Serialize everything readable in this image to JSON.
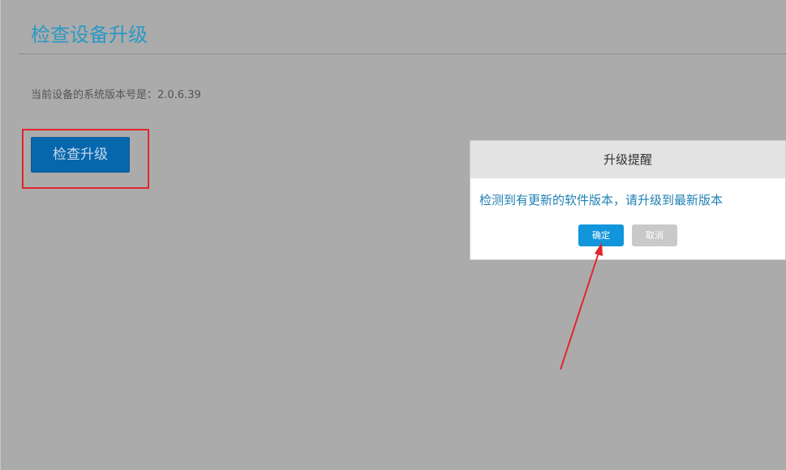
{
  "page": {
    "title": "检查设备升级",
    "version_text": "当前设备的系统版本号是：2.0.6.39",
    "check_button_label": "检查升级"
  },
  "dialog": {
    "title": "升级提醒",
    "message": "检测到有更新的软件版本，请升级到最新版本",
    "confirm_label": "确定",
    "cancel_label": "取消"
  },
  "annotations": {
    "highlight_color": "#e0262e",
    "arrow_color": "#e0262e"
  },
  "colors": {
    "title": "#2a98c4",
    "primary_button": "#0767ad",
    "confirm_button": "#1196dc",
    "cancel_button": "#c9c9c9",
    "overlay_background": "#ababab"
  }
}
